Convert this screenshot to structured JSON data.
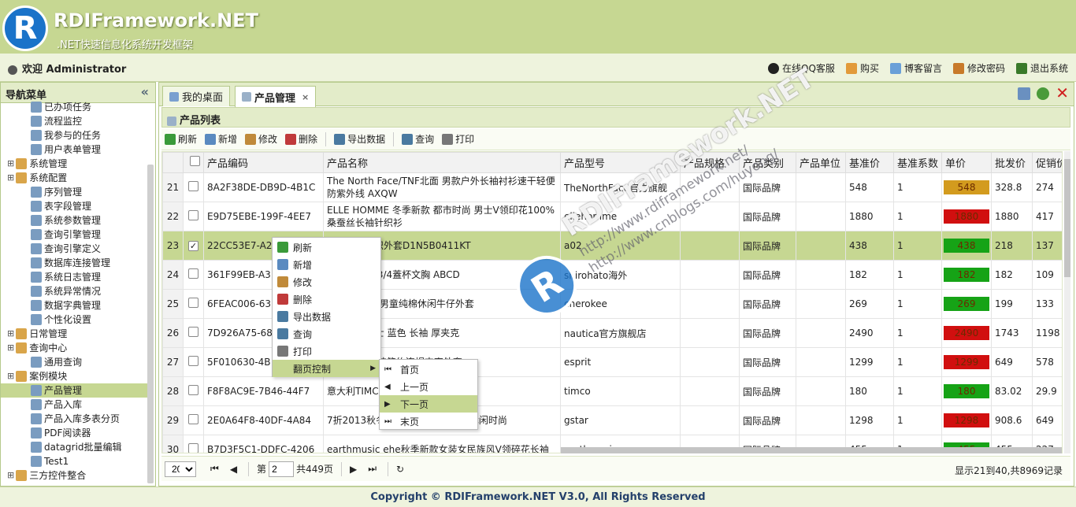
{
  "header": {
    "logo_letter": "R",
    "title": "RDIFramework.NET",
    "subtitle": ".NET快速信息化系统开发框架"
  },
  "userbar": {
    "welcome": "欢迎 Administrator",
    "links": [
      "在线QQ客服",
      "购买",
      "博客留言",
      "修改密码",
      "退出系统"
    ]
  },
  "nav": {
    "title": "导航菜单",
    "items": [
      {
        "label": "已办项任务",
        "level": 2
      },
      {
        "label": "流程监控",
        "level": 2
      },
      {
        "label": "我参与的任务",
        "level": 2
      },
      {
        "label": "用户表单管理",
        "level": 2
      },
      {
        "label": "系统管理",
        "level": 1
      },
      {
        "label": "系统配置",
        "level": 1
      },
      {
        "label": "序列管理",
        "level": 2
      },
      {
        "label": "表字段管理",
        "level": 2
      },
      {
        "label": "系统参数管理",
        "level": 2
      },
      {
        "label": "查询引擎管理",
        "level": 2
      },
      {
        "label": "查询引擎定义",
        "level": 2
      },
      {
        "label": "数据库连接管理",
        "level": 2
      },
      {
        "label": "系统日志管理",
        "level": 2
      },
      {
        "label": "系统异常情况",
        "level": 2
      },
      {
        "label": "数据字典管理",
        "level": 2
      },
      {
        "label": "个性化设置",
        "level": 2
      },
      {
        "label": "日常管理",
        "level": 1
      },
      {
        "label": "查询中心",
        "level": 1
      },
      {
        "label": "通用查询",
        "level": 2
      },
      {
        "label": "案例模块",
        "level": 1
      },
      {
        "label": "产品管理",
        "level": 2
      },
      {
        "label": "产品入库",
        "level": 2
      },
      {
        "label": "产品入库多表分页",
        "level": 2
      },
      {
        "label": "PDF阅读器",
        "level": 2
      },
      {
        "label": "datagrid批量编辑",
        "level": 2
      },
      {
        "label": "Test1",
        "level": 2
      },
      {
        "label": "三方控件整合",
        "level": 1
      }
    ],
    "selected": "产品管理"
  },
  "tabs": [
    {
      "label": "我的桌面"
    },
    {
      "label": "产品管理",
      "close": "×"
    }
  ],
  "panel": {
    "title": "产品列表"
  },
  "toolbar": [
    "刷新",
    "新增",
    "修改",
    "删除",
    "导出数据",
    "查询",
    "打印"
  ],
  "grid": {
    "columns": [
      "产品编码",
      "产品名称",
      "产品型号",
      "产品规格",
      "产品类别",
      "产品单位",
      "基准价",
      "基准系数",
      "单价",
      "批发价",
      "促销价"
    ],
    "rows": [
      {
        "n": "21",
        "checked": false,
        "code": "8A2F38DE-DB9D-4B1C",
        "name": "The North Face/TNF北面 男款户外长袖衬衫速干轻便防紫外线 AXQW",
        "model": "TheNorthFace官方旗舰",
        "spec": "",
        "cat": "国际品牌",
        "unit": "",
        "base": "548",
        "coef": "1",
        "price": "548",
        "price_color": "#d39b1e",
        "whole": "328.8",
        "promo": "274"
      },
      {
        "n": "22",
        "checked": false,
        "code": "E9D75EBE-199F-4EE7",
        "name": "ELLE HOMME 冬季新款 都市时尚 男士V领印花100%桑蚕丝长袖针织衫",
        "model": "ellehomme",
        "spec": "",
        "cat": "国际品牌",
        "unit": "",
        "base": "1880",
        "coef": "1",
        "price": "1880",
        "price_color": "#d10f0f",
        "whole": "1880",
        "promo": "417"
      },
      {
        "n": "23",
        "checked": true,
        "code": "22CC53E7-A2",
        "name": "时尚修身针织外套D1N5B0411KT",
        "model": "a02",
        "spec": "",
        "cat": "国际品牌",
        "unit": "",
        "base": "438",
        "coef": "1",
        "price": "438",
        "price_color": "#16a316",
        "whole": "218",
        "promo": "137"
      },
      {
        "n": "24",
        "checked": false,
        "code": "361F99EB-A3",
        "name": "可爱蕾絲邊 3/4蓋杯文胸 ABCD",
        "model": "shirohato海外",
        "spec": "",
        "cat": "国际品牌",
        "unit": "",
        "base": "182",
        "coef": "1",
        "price": "182",
        "price_color": "#16a316",
        "whole": "182",
        "promo": "109"
      },
      {
        "n": "25",
        "checked": false,
        "code": "6FEAC006-63",
        "name": "品cherokee男童纯棉休闲牛仔外套",
        "model": "cherokee",
        "spec": "",
        "cat": "国际品牌",
        "unit": "",
        "base": "269",
        "coef": "1",
        "price": "269",
        "price_color": "#16a316",
        "whole": "199",
        "promo": "133"
      },
      {
        "n": "26",
        "checked": false,
        "code": "7D926A75-68",
        "name": "N诺帝卡 男士 蓝色 长袖 厚夹克",
        "model": "nautica官方旗舰店",
        "spec": "",
        "cat": "国际品牌",
        "unit": "",
        "base": "2490",
        "coef": "1",
        "price": "2490",
        "price_color": "#d10f0f",
        "whole": "1743",
        "promo": "1198"
      },
      {
        "n": "27",
        "checked": false,
        "code": "5F010630-4B",
        "name": "斯普利特 男装简约连帽夹克外套",
        "model": "esprit",
        "spec": "",
        "cat": "国际品牌",
        "unit": "",
        "base": "1299",
        "coef": "1",
        "price": "1299",
        "price_color": "#d10f0f",
        "whole": "649",
        "promo": "578"
      },
      {
        "n": "28",
        "checked": false,
        "code": "F8F8AC9E-7B46-44F7",
        "name": "意大利TIMCO 正品 包邮",
        "model": "timco",
        "spec": "",
        "cat": "国际品牌",
        "unit": "",
        "base": "180",
        "coef": "1",
        "price": "180",
        "price_color": "#16a316",
        "whole": "83.02",
        "promo": "29.9"
      },
      {
        "n": "29",
        "checked": false,
        "code": "2E0A64F8-40DF-4A84",
        "name": "7折2013秋冬 gstar长袖立领男装休闲时尚",
        "model": "gstar",
        "spec": "",
        "cat": "国际品牌",
        "unit": "",
        "base": "1298",
        "coef": "1",
        "price": "1298",
        "price_color": "#d10f0f",
        "whole": "908.6",
        "promo": "649"
      },
      {
        "n": "30",
        "checked": false,
        "code": "B7D3F5C1-DDFC-4206",
        "name": "earthmusic ehe秋季新款女装女民族风V领碎花长袖",
        "model": "earthmusic",
        "spec": "",
        "cat": "国际品牌",
        "unit": "",
        "base": "455",
        "coef": "1",
        "price": "455",
        "price_color": "#16a316",
        "whole": "455",
        "promo": "227"
      }
    ]
  },
  "context_menu": {
    "items": [
      "刷新",
      "新增",
      "修改",
      "删除",
      "导出数据",
      "查询",
      "打印",
      "翻页控制"
    ],
    "submenu": [
      "首页",
      "上一页",
      "下一页",
      "末页"
    ]
  },
  "pager": {
    "page_size": "20",
    "page_prefix": "第",
    "page": "2",
    "page_suffix": "共449页",
    "info": "显示21到40,共8969记录"
  },
  "watermark": {
    "title": "RDIFramework.NET",
    "url1": "http://www.rdiframework.net/",
    "url2": "http://www.cnblogs.com/huyong/"
  },
  "footer": "Copyright © RDIFramework.NET V3.0, All Rights Reserved"
}
